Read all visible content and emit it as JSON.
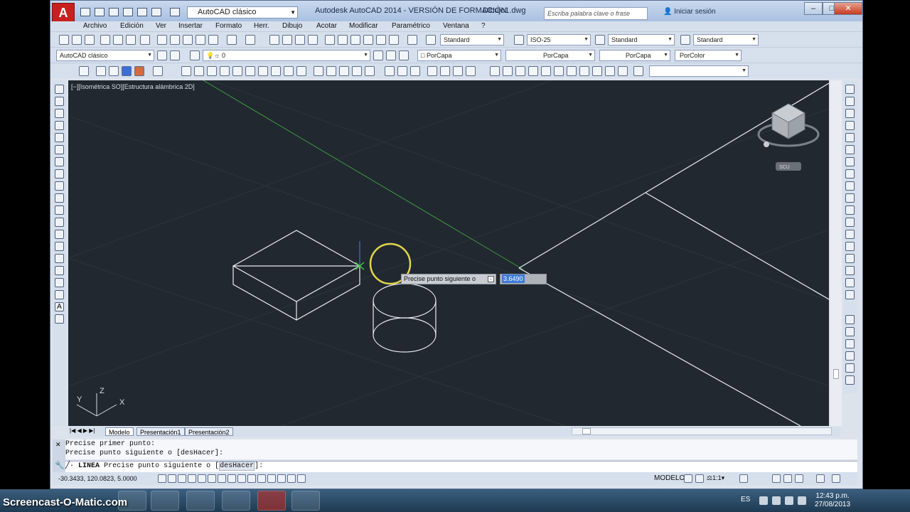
{
  "titlebar": {
    "workspace": "AutoCAD clásico",
    "title": "Autodesk AutoCAD 2014 - VERSIÓN DE FORMACIÓN",
    "document": "Dibujo1.dwg",
    "search_placeholder": "Escriba palabra clave o frase",
    "signin": "Iniciar sesión"
  },
  "menu": [
    "Archivo",
    "Edición",
    "Ver",
    "Insertar",
    "Formato",
    "Herr.",
    "Dibujo",
    "Acotar",
    "Modificar",
    "Paramétrico",
    "Ventana",
    "?"
  ],
  "styles_toolbar": {
    "text_style": "Standard",
    "dim_style": "ISO-25",
    "table_style": "Standard",
    "mleader_style": "Standard"
  },
  "layers_toolbar": {
    "workspace": "AutoCAD clásico",
    "layer": "0",
    "color": "PorCapa",
    "linetype": "PorCapa",
    "lineweight": "PorCapa",
    "plotstyle": "PorColor"
  },
  "viewport": {
    "label": "[−][Isométrica SO][Estructura alámbrica 2D]",
    "wcs": "SCU",
    "ucs_x": "X",
    "ucs_y": "Y",
    "ucs_z": "Z"
  },
  "dynamic_input": {
    "prompt": "Precise punto siguiente o",
    "value": "3.6490"
  },
  "tabs": [
    "Modelo",
    "Presentación1",
    "Presentación2"
  ],
  "command": {
    "history": [
      "Precise primer punto:",
      "Precise punto siguiente o [desHacer]:"
    ],
    "current_cmd": "LINEA",
    "current_prompt": "Precise punto siguiente o [",
    "option": "desHacer",
    "suffix": "]:"
  },
  "statusbar": {
    "coords": "-30.3433, 120.0823, 5.0000",
    "space": "MODELO",
    "scale": "1:1"
  },
  "taskbar": {
    "watermark": "Screencast-O-Matic.com",
    "lang": "ES",
    "time": "12:43 p.m.",
    "date": "27/08/2013"
  },
  "colors": {
    "canvas": "#212830",
    "ui": "#d6dfec",
    "accent": "#c8201e"
  }
}
